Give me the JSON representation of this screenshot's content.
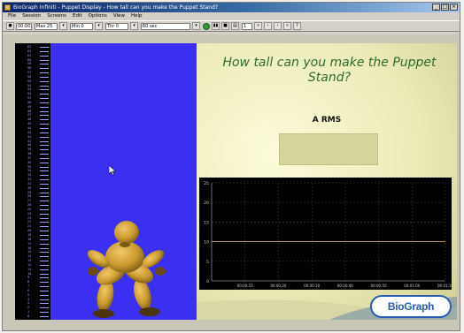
{
  "window": {
    "title": "BioGraph Infiniti - Puppet Display - How tall can you make the Puppet Stand?",
    "controls": [
      "_",
      "□",
      "×"
    ]
  },
  "menubar": [
    "File",
    "Session",
    "Screens",
    "Edit",
    "Options",
    "View",
    "Help"
  ],
  "toolbar": {
    "field1": "00:00",
    "field2": "Max 25",
    "field3": "Min 0",
    "field4": "Thr 0",
    "dropdown": "60 sec",
    "counter": "1"
  },
  "screen": {
    "question": "How tall can you make the Puppet Stand?",
    "rms_label": "A RMS"
  },
  "ruler": {
    "ticks": [
      "63",
      "62",
      "61",
      "60",
      "59",
      "58",
      "57",
      "56",
      "55",
      "54",
      "53",
      "52",
      "51",
      "50",
      "49",
      "48",
      "47",
      "46",
      "45",
      "44",
      "43",
      "42",
      "41",
      "40",
      "39",
      "38",
      "37",
      "36",
      "35",
      "34",
      "33",
      "32",
      "31",
      "30",
      "29",
      "28",
      "27",
      "26",
      "25",
      "24",
      "23",
      "22",
      "21",
      "20",
      "19",
      "18",
      "17",
      "16",
      "15",
      "14",
      "13",
      "12",
      "11",
      "10",
      "9",
      "8",
      "7",
      "6",
      "5",
      "4",
      "3",
      "2",
      "1",
      "0"
    ]
  },
  "chart_data": {
    "type": "line",
    "title": "",
    "xlabel": "",
    "ylabel": "",
    "y_ticks": [
      "25",
      "20",
      "15",
      "10",
      "5",
      "0"
    ],
    "x_ticks": [
      "00:00:10",
      "00:00:20",
      "00:00:30",
      "00:00:40",
      "00:00:50",
      "00:01:00",
      "00:01:10"
    ],
    "ylim": [
      0,
      25
    ],
    "threshold": 10,
    "grid": true,
    "colors": {
      "background": "#000000",
      "grid": "#3a3a3a",
      "threshold": "#c8a050",
      "axis_text": "#d0d0d0"
    }
  },
  "brand": {
    "logo_text": "BioGraph"
  },
  "colors": {
    "stage": "#3b2ff2",
    "puppet": "#c99a2e",
    "question_text": "#2e6b2e",
    "logo_blue": "#2a5db0"
  }
}
